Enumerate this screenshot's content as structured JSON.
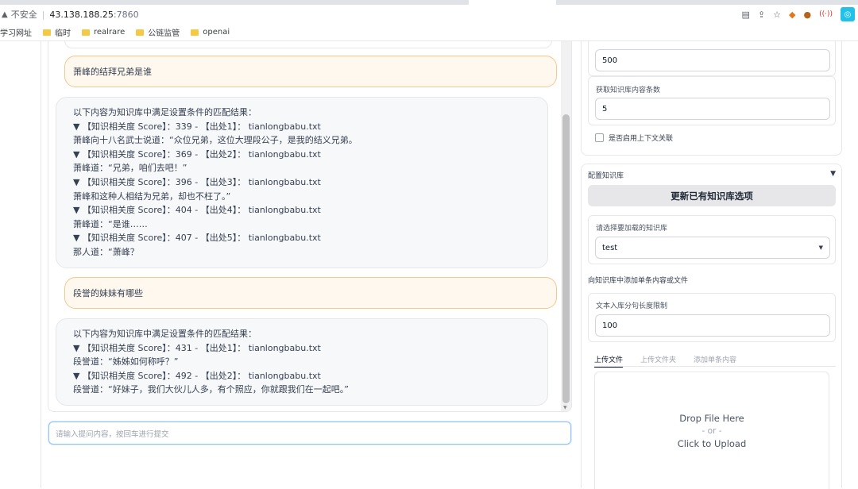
{
  "browser": {
    "insecure_label": "不安全",
    "separator": "|",
    "url_host": "43.138.188.25",
    "url_port": ":7860",
    "bookmarks": [
      "学习网址",
      "临时",
      "realrare",
      "公链监管",
      "openai"
    ]
  },
  "chat": {
    "messages": [
      {
        "role": "user",
        "text": "萧峰的结拜兄弟是谁"
      },
      {
        "role": "bot",
        "lines": [
          "以下内容为知识库中满足设置条件的匹配结果：",
          "▼ 【知识相关度 Score】：339 - 【出处1】：  tianlongbabu.txt",
          "萧峰向十八名武士说道：“众位兄弟，这位大理段公子，是我的结义兄弟。",
          "▼ 【知识相关度 Score】：369 - 【出处2】：  tianlongbabu.txt",
          "萧峰道：“兄弟，咱们去吧！”",
          "▼ 【知识相关度 Score】：396 - 【出处3】：  tianlongbabu.txt",
          "萧峰和这种人相结为兄弟，却也不枉了。”",
          "▼ 【知识相关度 Score】：404 - 【出处4】：  tianlongbabu.txt",
          "萧峰道：“是谁……",
          "▼ 【知识相关度 Score】：407 - 【出处5】：  tianlongbabu.txt",
          "那人道：“萧峰？"
        ]
      },
      {
        "role": "user",
        "text": "段誉的妹妹有哪些"
      },
      {
        "role": "bot",
        "lines": [
          "以下内容为知识库中满足设置条件的匹配结果：",
          "▼ 【知识相关度 Score】：431 - 【出处1】：  tianlongbabu.txt",
          "段誉道：“姊姊如何称呼？”",
          "▼ 【知识相关度 Score】：492 - 【出处2】：  tianlongbabu.txt",
          "段誉道：“好妹子，我们大伙儿人多，有个照应，你就跟我们在一起吧。”"
        ]
      }
    ],
    "input_placeholder": "请输入提问内容，按回车进行提交"
  },
  "settings": {
    "first_value": "500",
    "knowledge_count_label": "获取知识库内容条数",
    "knowledge_count_value": "5",
    "context_checkbox_label": "是否启用上下文关联"
  },
  "kb": {
    "header": "配置知识库",
    "collapse_glyph": "▼",
    "update_button": "更新已有知识库选项",
    "select_label": "请选择要加载的知识库",
    "select_value": "test",
    "select_arrow": "▼",
    "add_section_label": "向知识库中添加单条内容或文件",
    "chunk_label": "文本入库分句长度限制",
    "chunk_value": "100",
    "tabs": [
      "上传文件",
      "上传文件夹",
      "添加单条内容"
    ],
    "upload": {
      "line1": "Drop File Here",
      "line2": "- or -",
      "line3": "Click to Upload"
    }
  }
}
